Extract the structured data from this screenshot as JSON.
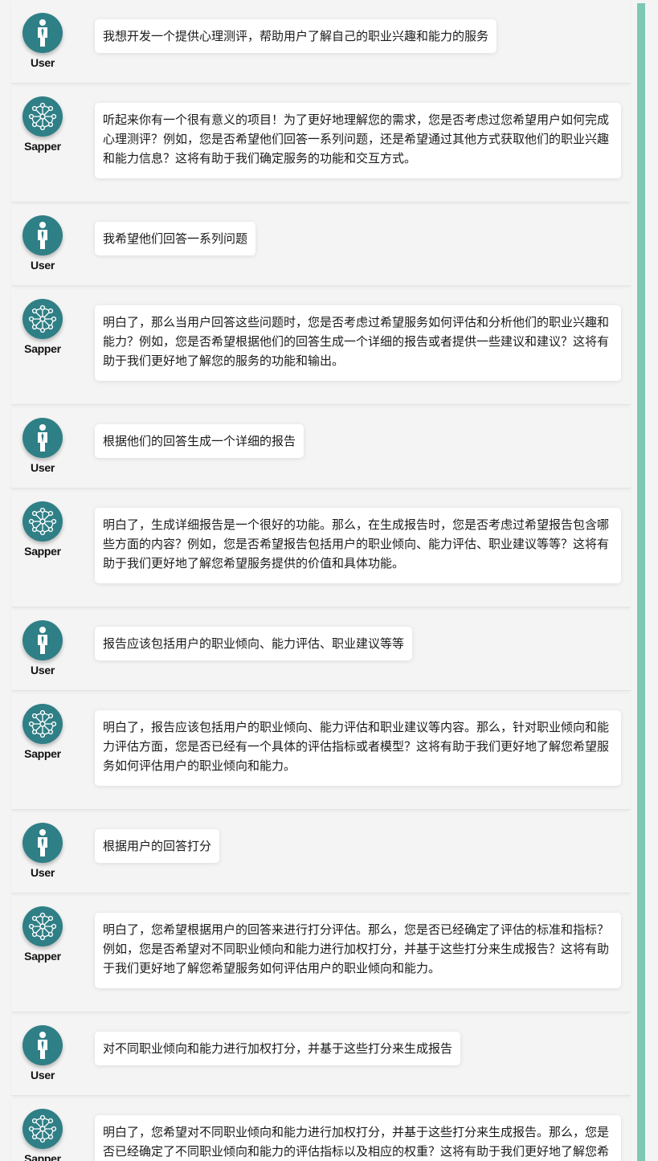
{
  "colors": {
    "avatar": "#2f7f86",
    "scrollbar": "#7cc8b5",
    "background": "#f4f4f4",
    "bubble": "#ffffff"
  },
  "roles": {
    "user": "User",
    "bot": "Sapper"
  },
  "icons": {
    "user": "person-icon",
    "bot": "network-icon"
  },
  "messages": [
    {
      "role": "user",
      "text": "我想开发一个提供心理测评，帮助用户了解自己的职业兴趣和能力的服务"
    },
    {
      "role": "bot",
      "text": "听起来你有一个很有意义的项目！为了更好地理解您的需求，您是否考虑过您希望用户如何完成心理测评？例如，您是否希望他们回答一系列问题，还是希望通过其他方式获取他们的职业兴趣和能力信息？这将有助于我们确定服务的功能和交互方式。"
    },
    {
      "role": "user",
      "text": "我希望他们回答一系列问题"
    },
    {
      "role": "bot",
      "text": "明白了，那么当用户回答这些问题时，您是否考虑过希望服务如何评估和分析他们的职业兴趣和能力？例如，您是否希望根据他们的回答生成一个详细的报告或者提供一些建议和建议？这将有助于我们更好地了解您的服务的功能和输出。"
    },
    {
      "role": "user",
      "text": "根据他们的回答生成一个详细的报告"
    },
    {
      "role": "bot",
      "text": "明白了，生成详细报告是一个很好的功能。那么，在生成报告时，您是否考虑过希望报告包含哪些方面的内容？例如，您是否希望报告包括用户的职业倾向、能力评估、职业建议等等？这将有助于我们更好地了解您希望服务提供的价值和具体功能。"
    },
    {
      "role": "user",
      "text": "报告应该包括用户的职业倾向、能力评估、职业建议等等"
    },
    {
      "role": "bot",
      "text": "明白了，报告应该包括用户的职业倾向、能力评估和职业建议等内容。那么，针对职业倾向和能力评估方面，您是否已经有一个具体的评估指标或者模型？这将有助于我们更好地了解您希望服务如何评估用户的职业倾向和能力。"
    },
    {
      "role": "user",
      "text": "根据用户的回答打分"
    },
    {
      "role": "bot",
      "text": "明白了，您希望根据用户的回答来进行打分评估。那么，您是否已经确定了评估的标准和指标？例如，您是否希望对不同职业倾向和能力进行加权打分，并基于这些打分来生成报告？这将有助于我们更好地了解您希望服务如何评估用户的职业倾向和能力。"
    },
    {
      "role": "user",
      "text": "对不同职业倾向和能力进行加权打分，并基于这些打分来生成报告"
    },
    {
      "role": "bot",
      "text": "明白了，您希望对不同职业倾向和能力进行加权打分，并基于这些打分来生成报告。那么，您是否已经确定了不同职业倾向和能力的评估指标以及相应的权重？这将有助于我们更好地了解您希望服务如何评估用户的职业倾向和能力，并生成相应的报告。"
    }
  ]
}
